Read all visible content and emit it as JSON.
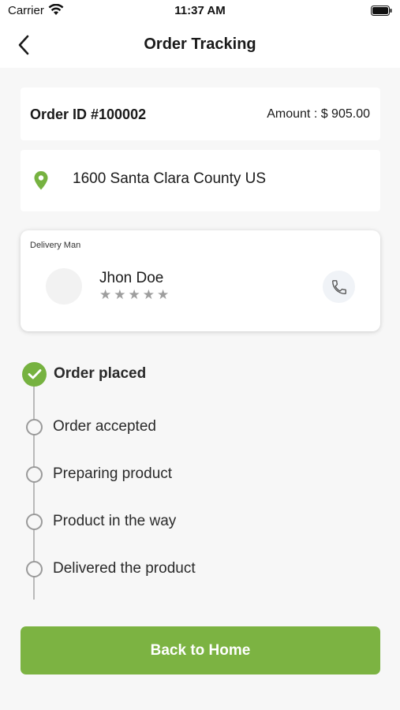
{
  "status_bar": {
    "carrier": "Carrier",
    "time": "11:37 AM"
  },
  "nav": {
    "title": "Order Tracking",
    "back_icon": "chevron-left-icon"
  },
  "order": {
    "id_label": "Order ID #100002",
    "amount_label": "Amount : $ 905.00"
  },
  "address": {
    "text": "1600 Santa Clara County US",
    "icon": "location-pin-icon"
  },
  "delivery": {
    "label": "Delivery Man",
    "name": "Jhon Doe",
    "rating": 0,
    "rating_max": 5,
    "stars": [
      "★",
      "★",
      "★",
      "★",
      "★"
    ],
    "call_icon": "phone-icon"
  },
  "timeline": {
    "steps": [
      {
        "label": "Order placed",
        "done": true
      },
      {
        "label": "Order accepted",
        "done": false
      },
      {
        "label": "Preparing product",
        "done": false
      },
      {
        "label": "Product in the way",
        "done": false
      },
      {
        "label": "Delivered the product",
        "done": false
      }
    ]
  },
  "actions": {
    "back_home": "Back to Home"
  },
  "colors": {
    "accent": "#7cb342",
    "pin": "#76b240",
    "background": "#f7f7f7"
  }
}
